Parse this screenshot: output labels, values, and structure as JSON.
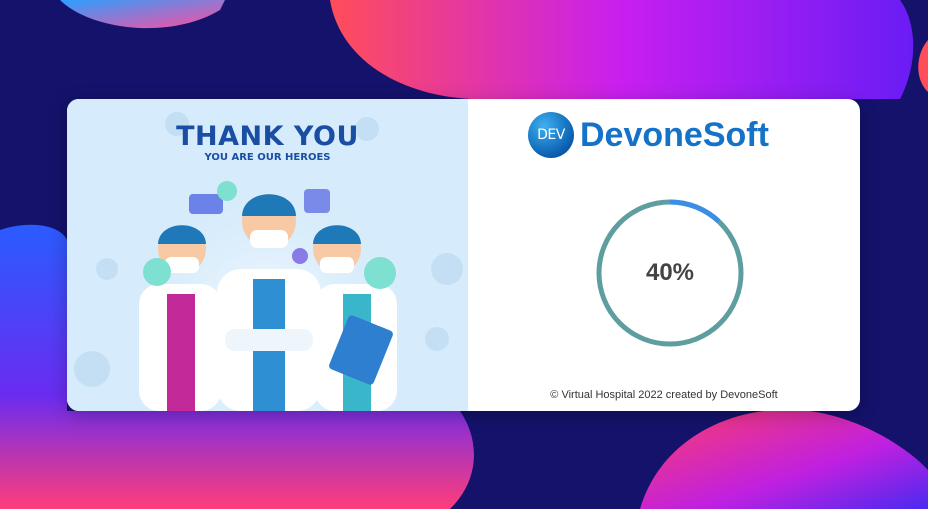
{
  "illustration": {
    "title": "THANK YOU",
    "subtitle": "YOU ARE OUR HEROES"
  },
  "brand": {
    "logo_badge": "DEV",
    "name": "DevoneSoft"
  },
  "loading": {
    "progress_label": "40%",
    "progress_value": 0.4,
    "track_color": "#5f9ea0",
    "fill_color": "#3a8ee6"
  },
  "footer": {
    "text": "© Virtual Hospital 2022 created by DevoneSoft"
  },
  "colors": {
    "background": "#14126b",
    "brand_blue": "#1472c8"
  }
}
